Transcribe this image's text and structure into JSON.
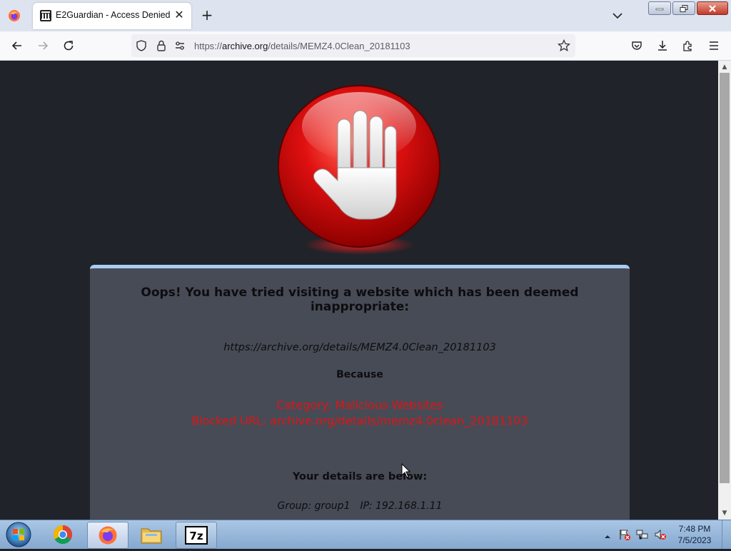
{
  "browser": {
    "tab": {
      "title": "E2Guardian - Access Denied"
    },
    "url": {
      "prefix": "https://",
      "host": "archive.org",
      "path": "/details/MEMZ4.0Clean_20181103"
    }
  },
  "blockpage": {
    "headline": "Oops! You have tried visiting a website which has been deemed inappropriate:",
    "blocked_url": "https://archive.org/details/MEMZ4.0Clean_20181103",
    "because_label": "Because",
    "category": "Category: Malicious Websites",
    "blocked_url_reason": "Blocked URL: archive.org/details/memz4.0clean_20181103",
    "details_heading": "Your details are below:",
    "group": "Group: group1",
    "ip": "IP: 192.168.1.11"
  },
  "taskbar": {
    "apps": [
      "chrome-icon",
      "firefox-icon",
      "file-explorer-icon",
      "7zip-icon"
    ],
    "clock": {
      "time": "7:48 PM",
      "date": "7/5/2023"
    }
  },
  "colors": {
    "page_background": "#202329",
    "card_background": "#474b56",
    "card_top_border": "#a9cdf0",
    "reason_text": "#e21313"
  }
}
